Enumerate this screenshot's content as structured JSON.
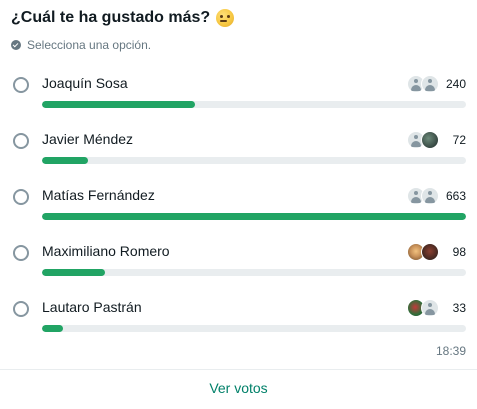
{
  "poll": {
    "question": "¿Cuál te ha gustado más?",
    "emoji": "thinking-face",
    "subtitle": "Selecciona una opción.",
    "options": [
      {
        "label": "Joaquín Sosa",
        "votes": "240",
        "fraction": 0.362,
        "avatars": [
          "placeholder",
          "placeholder"
        ]
      },
      {
        "label": "Javier Méndez",
        "votes": "72",
        "fraction": 0.109,
        "avatars": [
          "placeholder",
          "photo-dark"
        ]
      },
      {
        "label": "Matías Fernández",
        "votes": "663",
        "fraction": 1.0,
        "avatars": [
          "placeholder",
          "placeholder"
        ]
      },
      {
        "label": "Maximiliano Romero",
        "votes": "98",
        "fraction": 0.148,
        "avatars": [
          "photo-face1",
          "photo-face2"
        ]
      },
      {
        "label": "Lautaro Pastrán",
        "votes": "33",
        "fraction": 0.05,
        "avatars": [
          "photo-red",
          "placeholder"
        ]
      }
    ],
    "time": "18:39",
    "view_votes_label": "Ver votos"
  },
  "colors": {
    "bar_fill": "#21a464",
    "bar_track": "#e9edef",
    "link": "#008069"
  }
}
